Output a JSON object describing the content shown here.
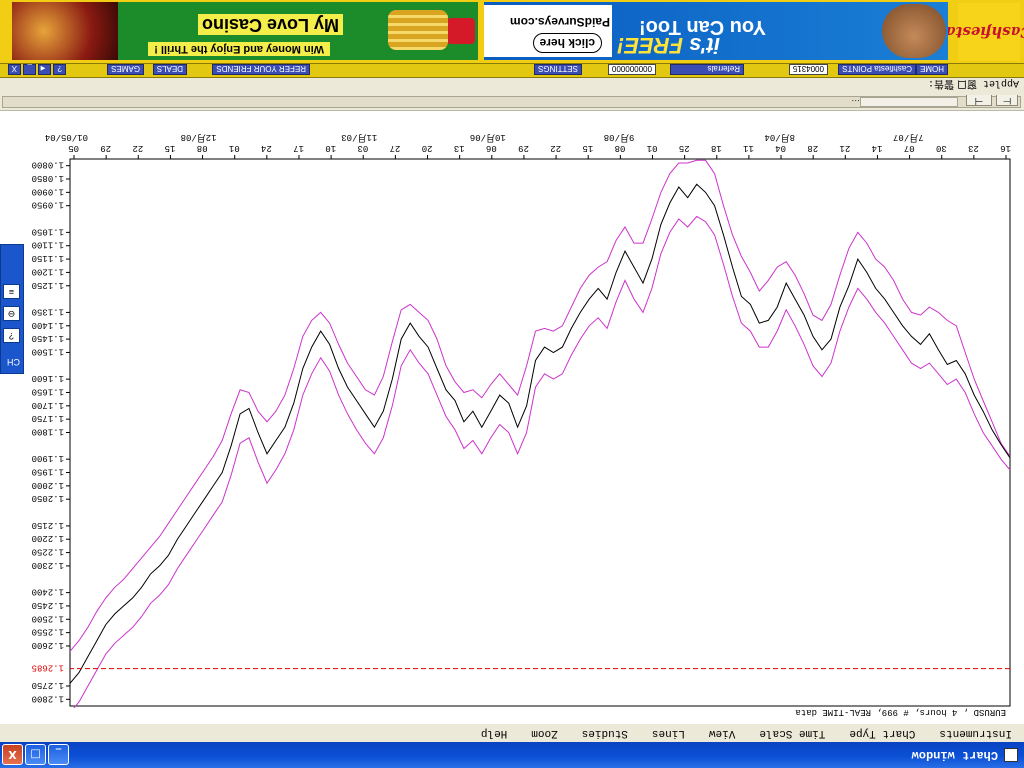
{
  "window": {
    "title": "Chart window",
    "minimize_label": "_",
    "maximize_label": "□",
    "close_label": "X"
  },
  "menu": [
    "Instruments",
    "Chart Type",
    "Time Scale",
    "View",
    "Lines",
    "Studies",
    "Zoom",
    "Help"
  ],
  "status_text": "EURUSD , 4 hours, # 999, REAL-TIME data",
  "chart_data": {
    "type": "line",
    "instrument": "EURUSD",
    "timeframe": "4 hours",
    "bars": "999",
    "ylim": [
      1.0775,
      1.2825
    ],
    "y_axis_inverted": true,
    "y_ticks": [
      "1.0800",
      "1.0850",
      "1.0900",
      "1.0950",
      "1.1050",
      "1.1100",
      "1.1150",
      "1.1200",
      "1.1250",
      "1.1350",
      "1.1400",
      "1.1450",
      "1.1500",
      "1.1600",
      "1.1650",
      "1.1700",
      "1.1750",
      "1.1800",
      "1.1900",
      "1.1950",
      "1.2000",
      "1.2050",
      "1.2150",
      "1.2200",
      "1.2250",
      "1.2300",
      "1.2400",
      "1.2450",
      "1.2500",
      "1.2550",
      "1.2600",
      "1.2750",
      "1.2800"
    ],
    "y_tick_values": [
      1.08,
      1.085,
      1.09,
      1.095,
      1.105,
      1.11,
      1.115,
      1.12,
      1.125,
      1.135,
      1.14,
      1.145,
      1.15,
      1.16,
      1.165,
      1.17,
      1.175,
      1.18,
      1.19,
      1.195,
      1.2,
      1.205,
      1.215,
      1.22,
      1.225,
      1.23,
      1.24,
      1.245,
      1.25,
      1.255,
      1.26,
      1.275,
      1.28
    ],
    "current_price_label": "1.2685",
    "current_price": 1.2685,
    "x_ticks": [
      "16",
      "23",
      "30",
      "07",
      "14",
      "21",
      "28",
      "04",
      "11",
      "18",
      "25",
      "01",
      "08",
      "15",
      "22",
      "29",
      "06",
      "13",
      "20",
      "27",
      "03",
      "10",
      "17",
      "24",
      "01",
      "08",
      "15",
      "22",
      "29",
      "05"
    ],
    "x_month_labels": [
      {
        "index": 3,
        "label": "7月/07"
      },
      {
        "index": 7,
        "label": "8月/04"
      },
      {
        "index": 12,
        "label": "9月/08"
      },
      {
        "index": 16,
        "label": "10月/06"
      },
      {
        "index": 20,
        "label": "11月/03"
      },
      {
        "index": 25,
        "label": "12月/08"
      },
      {
        "index": 29,
        "label": "01/05/04"
      }
    ],
    "series": [
      {
        "role": "price",
        "color": "#000000",
        "values": [
          1.1895,
          1.1845,
          1.179,
          1.172,
          1.166,
          1.158,
          1.153,
          1.1545,
          1.149,
          1.143,
          1.147,
          1.144,
          1.14,
          1.135,
          1.13,
          1.126,
          1.12,
          1.115,
          1.125,
          1.133,
          1.145,
          1.149,
          1.144,
          1.136,
          1.13,
          1.124,
          1.133,
          1.138,
          1.139,
          1.132,
          1.129,
          1.118,
          1.106,
          1.095,
          1.09,
          1.087,
          1.092,
          1.088,
          1.094,
          1.102,
          1.115,
          1.124,
          1.118,
          1.112,
          1.12,
          1.13,
          1.126,
          1.13,
          1.135,
          1.141,
          1.148,
          1.15,
          1.148,
          1.153,
          1.17,
          1.178,
          1.169,
          1.166,
          1.172,
          1.178,
          1.172,
          1.176,
          1.168,
          1.164,
          1.156,
          1.148,
          1.144,
          1.139,
          1.145,
          1.16,
          1.172,
          1.178,
          1.173,
          1.168,
          1.163,
          1.156,
          1.147,
          1.142,
          1.148,
          1.156,
          1.169,
          1.178,
          1.183,
          1.188,
          1.18,
          1.171,
          1.173,
          1.185,
          1.195,
          1.2,
          1.205,
          1.21,
          1.215,
          1.22,
          1.226,
          1.23,
          1.233,
          1.238,
          1.242,
          1.245,
          1.248,
          1.252,
          1.258,
          1.264,
          1.27,
          1.274
        ]
      },
      {
        "role": "upper-band",
        "color": "#cc33cc",
        "values": [
          1.189,
          1.184,
          1.176,
          1.168,
          1.16,
          1.15,
          1.14,
          1.138,
          1.135,
          1.133,
          1.136,
          1.135,
          1.13,
          1.123,
          1.118,
          1.115,
          1.109,
          1.105,
          1.111,
          1.121,
          1.132,
          1.138,
          1.136,
          1.128,
          1.121,
          1.116,
          1.118,
          1.123,
          1.127,
          1.12,
          1.114,
          1.106,
          1.095,
          1.083,
          1.078,
          1.078,
          1.079,
          1.079,
          1.083,
          1.09,
          1.1,
          1.109,
          1.109,
          1.103,
          1.108,
          1.116,
          1.118,
          1.121,
          1.126,
          1.133,
          1.14,
          1.142,
          1.141,
          1.142,
          1.155,
          1.166,
          1.162,
          1.158,
          1.162,
          1.167,
          1.164,
          1.165,
          1.161,
          1.155,
          1.145,
          1.138,
          1.135,
          1.132,
          1.134,
          1.146,
          1.159,
          1.166,
          1.164,
          1.159,
          1.154,
          1.147,
          1.139,
          1.135,
          1.138,
          1.144,
          1.156,
          1.166,
          1.172,
          1.176,
          1.172,
          1.165,
          1.164,
          1.173,
          1.183,
          1.189,
          1.194,
          1.199,
          1.204,
          1.209,
          1.214,
          1.219,
          1.223,
          1.227,
          1.231,
          1.235,
          1.238,
          1.242,
          1.247,
          1.253,
          1.258,
          1.262
        ]
      },
      {
        "role": "lower-band",
        "color": "#cc33cc",
        "values": [
          1.194,
          1.19,
          1.185,
          1.18,
          1.173,
          1.165,
          1.16,
          1.162,
          1.158,
          1.154,
          1.156,
          1.154,
          1.149,
          1.144,
          1.139,
          1.135,
          1.13,
          1.126,
          1.133,
          1.142,
          1.154,
          1.159,
          1.155,
          1.147,
          1.14,
          1.134,
          1.142,
          1.148,
          1.148,
          1.142,
          1.139,
          1.129,
          1.117,
          1.106,
          1.101,
          1.099,
          1.103,
          1.1,
          1.105,
          1.113,
          1.126,
          1.135,
          1.13,
          1.123,
          1.131,
          1.141,
          1.137,
          1.14,
          1.145,
          1.151,
          1.158,
          1.16,
          1.158,
          1.163,
          1.18,
          1.188,
          1.18,
          1.177,
          1.182,
          1.188,
          1.183,
          1.186,
          1.179,
          1.174,
          1.166,
          1.158,
          1.154,
          1.149,
          1.155,
          1.17,
          1.182,
          1.188,
          1.184,
          1.179,
          1.173,
          1.166,
          1.157,
          1.152,
          1.158,
          1.166,
          1.179,
          1.188,
          1.194,
          1.199,
          1.191,
          1.182,
          1.184,
          1.196,
          1.206,
          1.211,
          1.216,
          1.221,
          1.226,
          1.231,
          1.237,
          1.241,
          1.244,
          1.249,
          1.253,
          1.256,
          1.259,
          1.263,
          1.269,
          1.275,
          1.281,
          1.285
        ]
      }
    ]
  },
  "toolbar": {
    "dots": "...",
    "btn_a": "⊢",
    "btn_b": "⊣",
    "applet_label": "Applet 窗口",
    "applet_icon_label": "警告:"
  },
  "nav": {
    "home": "HOME",
    "cashfiesta_points": "Cashfiesta POINTS",
    "points_value": "0004315",
    "referrals": "Referrals",
    "referrals_value": "000000000",
    "settings": "SETTINGS",
    "refer": "REFER YOUR FRIENDS",
    "deals": "DEALS",
    "games": "GAMES",
    "btn1": "?",
    "btn2": "◄",
    "btn3": "_",
    "btn4": "X"
  },
  "banner": {
    "logo": "Cashfiesta",
    "you_can": "You Can Too!",
    "its": "it's",
    "free": "FREE!",
    "click": "click here",
    "paid": "PaidSurveys.com",
    "casino": "My Love Casino",
    "thrill": "Win Money and Enjoy the Thrill !"
  },
  "sidepanel": {
    "label": "CH",
    "btn_help": "?",
    "btn_stop": "⊖",
    "btn_list": "≡"
  },
  "colors": {
    "price": "#000000",
    "bands": "#cc33cc",
    "price_line": "#dd0000",
    "titlebar": "#0b4fd6"
  }
}
